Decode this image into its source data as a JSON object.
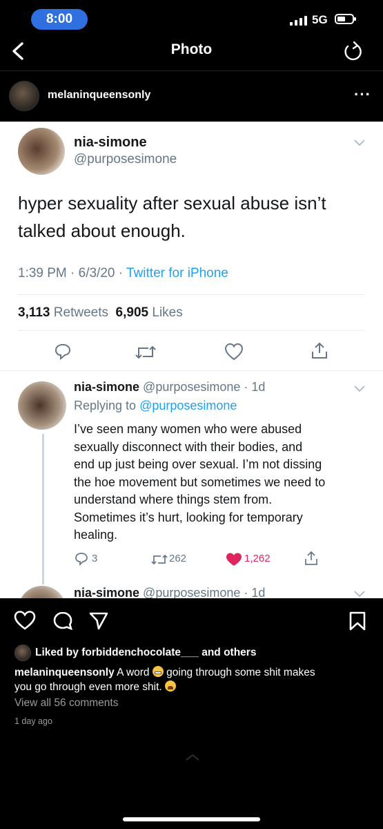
{
  "status_bar": {
    "time": "8:00",
    "network": "5G"
  },
  "nav": {
    "title": "Photo"
  },
  "post": {
    "username": "melaninqueensonly",
    "liked_by_prefix": "Liked by",
    "liked_by_user": "forbiddenchocolate___",
    "liked_by_and": "and",
    "liked_by_others": "others",
    "caption_user": "melaninqueensonly",
    "caption_part1": "A word",
    "caption_part2": "going through some shit makes",
    "caption_part3": "you go through even more shit.",
    "view_comments": "View all 56 comments",
    "time_ago": "1 day ago"
  },
  "tweet": {
    "display_name": "nia-simone",
    "handle": "@purposesimone",
    "text_line1": "hyper sexuality after sexual abuse isn’t",
    "text_line2": "talked about enough.",
    "timestamp": "1:39 PM · 6/3/20 ·",
    "source": "Twitter for iPhone",
    "retweets_count": "3,113",
    "retweets_label": "Retweets",
    "likes_count": "6,905",
    "likes_label": "Likes"
  },
  "reply": {
    "display_name": "nia-simone",
    "meta": "@purposesimone · 1d",
    "replying_prefix": "Replying to",
    "replying_handle": "@purposesimone",
    "lines": [
      "I’ve seen many women who were abused",
      "sexually disconnect with their bodies, and",
      "end up just being over sexual. I’m not dissing",
      "the hoe movement but sometimes we need to",
      "understand where things stem from.",
      "Sometimes it’s hurt, looking for temporary",
      "healing."
    ],
    "replies": "3",
    "retweets": "262",
    "likes": "1,262"
  },
  "reply2": {
    "display_name": "nia-simone",
    "meta": "@purposesimone · 1d"
  },
  "colors": {
    "status_pill": "#2f6fe0",
    "twitter_blue": "#1da1f2",
    "like_red": "#e0245e",
    "gray": "#657786"
  }
}
